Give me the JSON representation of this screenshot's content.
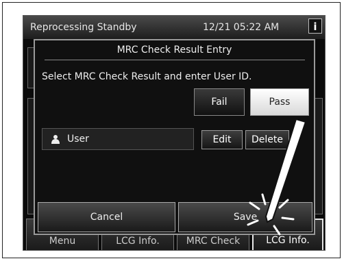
{
  "status_bar": {
    "mode": "Reprocessing Standby",
    "datetime": "12/21 05:22 AM",
    "info_icon": "info-icon"
  },
  "bottom_tabs": [
    "Menu",
    "LCG Info.",
    "MRC Check",
    "LCG Info."
  ],
  "dialog": {
    "title": "MRC Check Result Entry",
    "instruction": "Select MRC Check Result and enter User ID.",
    "fail_label": "Fail",
    "pass_label": "Pass",
    "user_label": "User",
    "user_icon": "user-icon",
    "edit_label": "Edit",
    "delete_label": "Delete",
    "cancel_label": "Cancel",
    "save_label": "Save"
  },
  "colors": {
    "screen_bg": "#0b0b0b",
    "pass_selected": "#f0f0f0",
    "text": "#eeeeee"
  }
}
